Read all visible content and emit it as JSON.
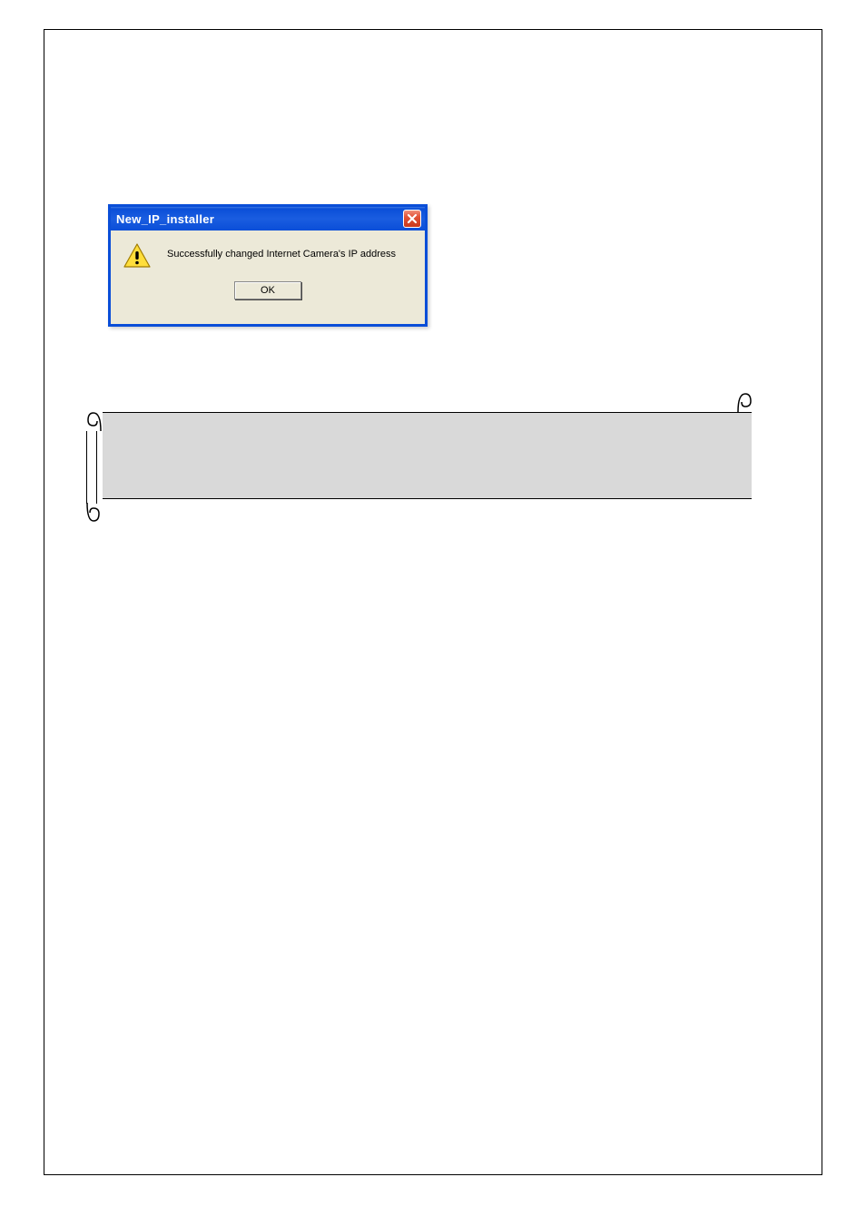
{
  "dialog": {
    "title": "New_IP_installer",
    "message": "Successfully changed Internet Camera's IP address",
    "ok_label": "OK"
  }
}
